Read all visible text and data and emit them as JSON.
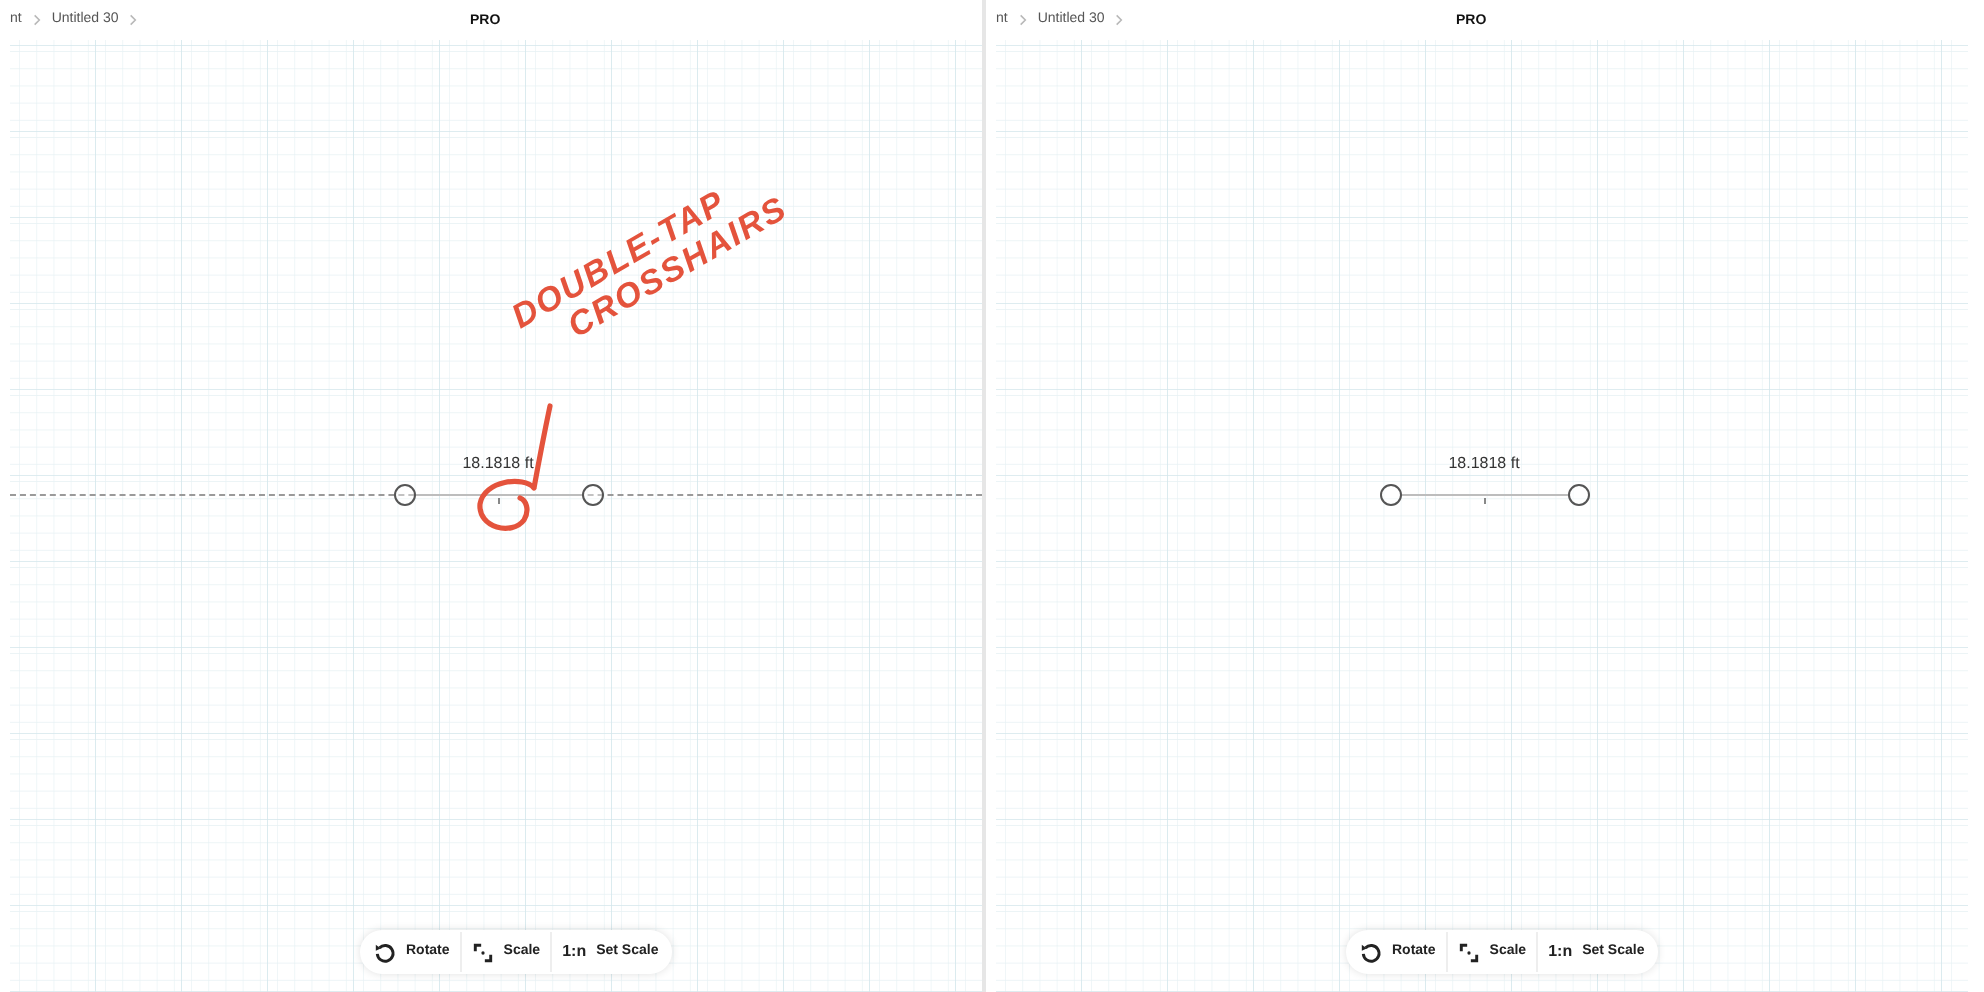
{
  "panels": [
    {
      "breadcrumb": [
        "nt",
        "Untitled 30"
      ],
      "badge": "PRO",
      "measurement": "18.1818 ft",
      "crosshair_guide": true,
      "annotation": {
        "lines": [
          "DOUBLE-TAP",
          "CROSSHAIRS"
        ],
        "color": "#e4533c"
      },
      "toolbar": [
        {
          "kind": "rotate",
          "label": "Rotate"
        },
        {
          "kind": "scale",
          "label": "Scale"
        },
        {
          "kind": "ratio",
          "glyph": "1:n",
          "label": "Set Scale"
        }
      ]
    },
    {
      "breadcrumb": [
        "nt",
        "Untitled 30"
      ],
      "badge": "PRO",
      "measurement": "18.1818 ft",
      "crosshair_guide": false,
      "toolbar": [
        {
          "kind": "rotate",
          "label": "Rotate"
        },
        {
          "kind": "scale",
          "label": "Scale"
        },
        {
          "kind": "ratio",
          "glyph": "1:n",
          "label": "Set Scale"
        }
      ]
    }
  ]
}
